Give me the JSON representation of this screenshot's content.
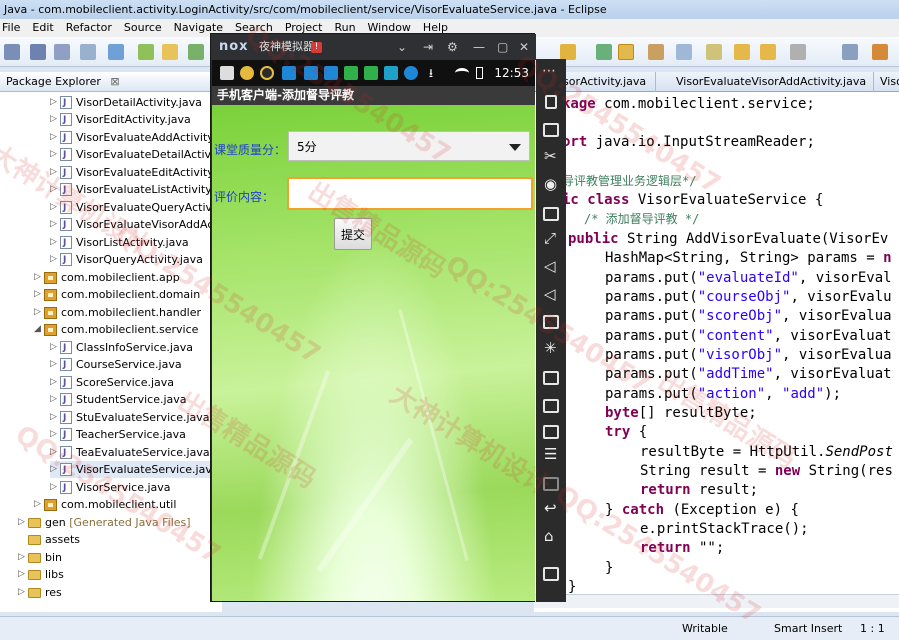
{
  "window": {
    "title": "Java - com.mobileclient.activity.LoginActivity/src/com/mobileclient/service/VisorEvaluateService.java - Eclipse"
  },
  "menu": [
    "File",
    "Edit",
    "Refactor",
    "Source",
    "Navigate",
    "Search",
    "Project",
    "Run",
    "Window",
    "Help"
  ],
  "package_explorer": {
    "title": "Package Explorer",
    "items": [
      "VisorDetailActivity.java",
      "VisorEditActivity.java",
      "VisorEvaluateAddActivity.java",
      "VisorEvaluateDetailActivity.java",
      "VisorEvaluateEditActivity.java",
      "VisorEvaluateListActivity.java",
      "VisorEvaluateQueryActivity.java",
      "VisorEvaluateVisorAddActivity.java",
      "VisorListActivity.java",
      "VisorQueryActivity.java",
      "com.mobileclient.app",
      "com.mobileclient.domain",
      "com.mobileclient.handler",
      "com.mobileclient.service",
      "ClassInfoService.java",
      "CourseService.java",
      "ScoreService.java",
      "StudentService.java",
      "StuEvaluateService.java",
      "TeacherService.java",
      "TeaEvaluateService.java",
      "VisorEvaluateService.java",
      "VisorService.java",
      "com.mobileclient.util",
      "gen",
      "[Generated Java Files]",
      "assets",
      "bin",
      "libs",
      "res"
    ]
  },
  "editor": {
    "tabs": [
      "isorActivity.java",
      "VisorEvaluateVisorAddActivity.java",
      "Viso"
    ],
    "code": {
      "l1a": "kage",
      "l1b": " com.mobileclient.service;",
      "l2a": "ort",
      "l2b": " java.io.InputStreamReader;",
      "l3": "导评教管理业务逻辑层*/",
      "l4a": "ic class",
      "l4b": " VisorEvaluateService {",
      "l5": "/* 添加督导评教 */",
      "l6a": "public",
      "l6b": " String AddVisorEvaluate(VisorEv",
      "l7a": "HashMap<String, String> params = ",
      "l7b": "n",
      "p1a": "params.put(",
      "p1s": "\"evaluateId\"",
      "p1b": ", visorEval",
      "p2a": "params.put(",
      "p2s": "\"courseObj\"",
      "p2b": ", visorEvalu",
      "p3a": "params.put(",
      "p3s": "\"scoreObj\"",
      "p3b": ", visorEvalua",
      "p4a": "params.put(",
      "p4s": "\"content\"",
      "p4b": ", visorEvaluat",
      "p5a": "params.put(",
      "p5s": "\"visorObj\"",
      "p5b": ", visorEvalua",
      "p6a": "params.put(",
      "p6s": "\"addTime\"",
      "p6b": ", visorEvaluat",
      "p7a": "params.put(",
      "p7s": "\"action\"",
      "p7c": ", ",
      "p7t": "\"add\"",
      "p7b": ");",
      "b1a": "byte",
      "b1b": "[] resultByte;",
      "t1a": "try",
      "t1b": " {",
      "r1a": "resultByte = HttpUtil.",
      "r1b": "SendPost",
      "r2a": "String result = ",
      "r2k": "new",
      "r2b": " String(res",
      "r3a": "return",
      "r3b": " result;",
      "c1a": "} ",
      "c1k": "catch",
      "c1b": " (Exception e) {",
      "c2": "e.printStackTrace();",
      "c3a": "return",
      "c3b": " \"\";",
      "c4": "}",
      "c5": "}"
    }
  },
  "status_bar": {
    "mode": "Writable",
    "insert": "Smart Insert",
    "position": "1 : 1"
  },
  "emulator": {
    "logo": "nox",
    "name": "夜神模拟器",
    "badge": "!",
    "clock": "12:53",
    "app_title": "手机客户端-添加督导评教",
    "score_label": "课堂质量分：",
    "score_value": "5分",
    "content_label": "评价内容：",
    "content_value": "",
    "submit_label": "提交"
  },
  "watermark": [
    "QQ:2545540457",
    "大神计算机设计",
    "出售精品源码"
  ]
}
